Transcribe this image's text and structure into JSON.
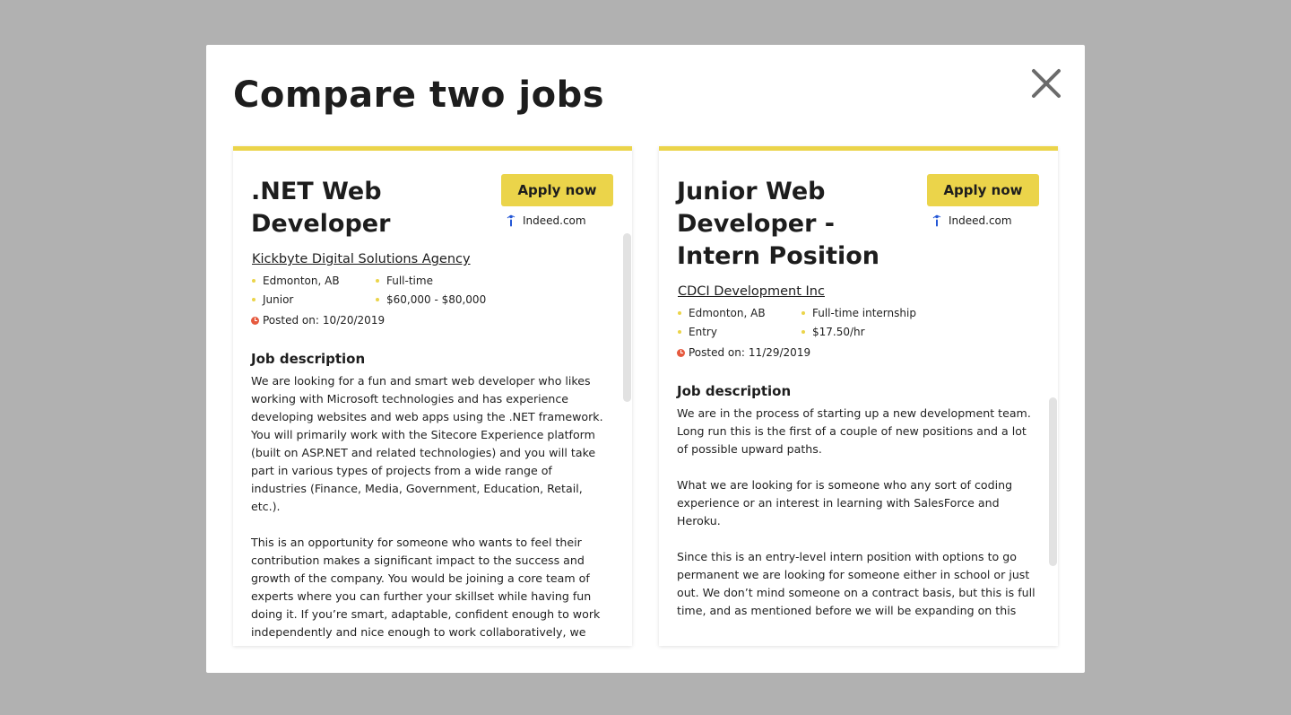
{
  "modal": {
    "title": "Compare two jobs",
    "close_label": "Close"
  },
  "colors": {
    "accent": "#ebd44a",
    "backdrop": "#b1b1b1",
    "posted_icon": "#e65a3f",
    "source_icon": "#2457d6"
  },
  "jobs": [
    {
      "title_lines": [
        ".NET Web",
        "Developer"
      ],
      "apply_label": "Apply now",
      "source": "Indeed.com",
      "source_icon": "indeed-icon",
      "company": "Kickbyte Digital Solutions Agency",
      "location": "Edmonton, AB",
      "employment_type": "Full-time",
      "level": "Junior",
      "salary": "$60,000 - $80,000",
      "posted_label": "Posted on:",
      "posted_date": "10/20/2019",
      "description_heading": "Job description",
      "description": [
        "We are looking for a fun and smart web developer who likes working with Microsoft technologies and has experience developing websites and web apps using the .NET framework. You will primarily work with the Sitecore Experience platform (built on ASP.NET and related technologies) and you will take part in various types of projects from a wide range of industries (Finance, Media, Government, Education, Retail, etc.).",
        "This is an opportunity for someone who wants to feel their contribution makes a significant impact to the success and growth of the company. You would be joining a core team of experts where you can further your skillset while having fun doing it. If you’re smart, adaptable, confident enough to work independently and nice enough to work collaboratively, we"
      ]
    },
    {
      "title_lines": [
        "Junior Web",
        "Developer -",
        "Intern Position"
      ],
      "apply_label": "Apply now",
      "source": "Indeed.com",
      "source_icon": "indeed-icon",
      "company": "CDCI Development Inc",
      "location": "Edmonton, AB",
      "employment_type": "Full-time internship",
      "level": "Entry",
      "salary": "$17.50/hr",
      "posted_label": "Posted on:",
      "posted_date": "11/29/2019",
      "description_heading": "Job description",
      "description": [
        "We are in the process of starting up a new development team. Long run this is the first of a couple of new positions and a lot of possible upward paths.",
        "What we are looking for is someone who any sort of coding experience or an interest in learning with SalesForce and Heroku.",
        "Since this is an entry-level intern position with options to go permanent we are looking for someone either in school or just out. We don’t mind someone on a contract basis, but this is full time, and as mentioned before we will be expanding on this"
      ]
    }
  ]
}
